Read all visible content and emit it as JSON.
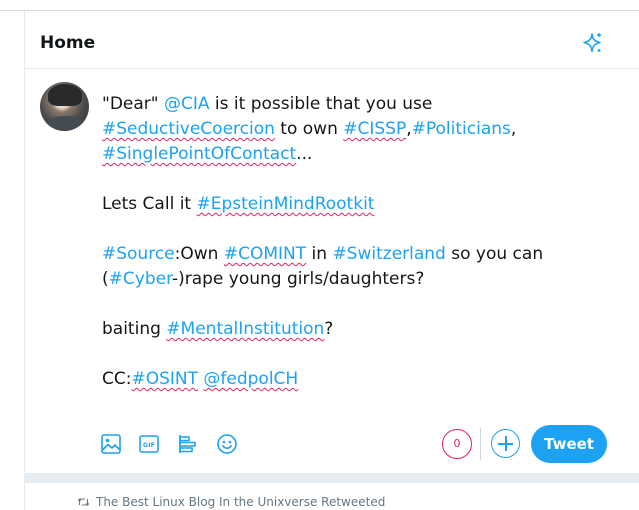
{
  "header": {
    "title": "Home",
    "icon": "sparkle-icon"
  },
  "composer": {
    "line1": {
      "q": "\"Dear\" ",
      "mention": "@CIA",
      "rest": " is it possible that you use"
    },
    "line2": {
      "tag1": "#SeductiveCoercion",
      "mid": " to own ",
      "tag2": "#CISSP",
      "comma": ",",
      "tag3": "#Politicians",
      "end": ","
    },
    "line3": {
      "tag": "#SinglePointOfContact",
      "end": "..."
    },
    "line4": {
      "pre": "Lets Call it ",
      "tag": "#EpsteinMindRootkit"
    },
    "line5": {
      "tag1": "#Source",
      "mid1": ":Own ",
      "tag2": "#COMINT",
      "mid2": " in ",
      "tag3": "#Switzerland",
      "end": " so you can"
    },
    "line6": {
      "pre": "(",
      "tag": "#Cyber",
      "end": "-)rape young girls/daughters?"
    },
    "line7": {
      "pre": "baiting ",
      "tag": "#MentalInstitution",
      "end": "?"
    },
    "line8": {
      "pre": "CC:",
      "tag": "#OSINT",
      "sp": " ",
      "mention": "@fedpolCH"
    }
  },
  "toolbar": {
    "icons": [
      "image-icon",
      "gif-icon",
      "poll-icon",
      "emoji-icon"
    ],
    "gif_label": "GIF",
    "char_counter": "0",
    "add_icon": "plus-icon",
    "tweet_label": "Tweet"
  },
  "feed": {
    "retweet_text": "The Best Linux Blog In the Unixverse Retweeted",
    "retweet_icon": "retweet-icon"
  },
  "colors": {
    "accent": "#1da1f2",
    "danger": "#e0245e",
    "text": "#14171a",
    "muted": "#657786"
  }
}
